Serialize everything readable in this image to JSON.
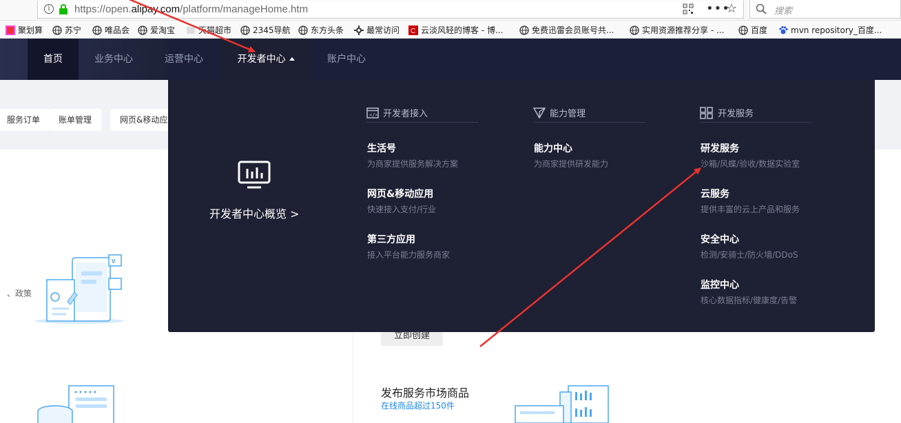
{
  "browser": {
    "url_prefix": "https://open.",
    "url_domain": "alipay.com",
    "url_path": "/platform/manageHome.htm",
    "search_placeholder": "搜索",
    "bookmarks": [
      "聚划算",
      "苏宁",
      "唯品会",
      "爱淘宝",
      "天猫超市",
      "2345导航",
      "东方头条",
      "最常访问",
      "云淡风轻的博客 - 博...",
      "免费迅雷会员账号共...",
      "实用资源推荐分享 - ...",
      "百度",
      "mvn repository_百度..."
    ]
  },
  "nav": {
    "items": [
      "首页",
      "业务中心",
      "运营中心",
      "开发者中心",
      "账户中心"
    ]
  },
  "page": {
    "pills": [
      "服务订单",
      "账单管理",
      "网页&移动应"
    ],
    "side_text": "、政策",
    "create_button": "立即创建",
    "publish_title": "发布服务市场商品",
    "publish_sub": "在线商品超过150件"
  },
  "dropdown": {
    "overview": "开发者中心概览 >",
    "columns": [
      {
        "heading": "开发者接入",
        "items": [
          {
            "title": "生活号",
            "desc": "为商家提供服务解决方案"
          },
          {
            "title": "网页&移动应用",
            "desc": "快速接入支付/行业"
          },
          {
            "title": "第三方应用",
            "desc": "接入平台能力服务商家"
          }
        ]
      },
      {
        "heading": "能力管理",
        "items": [
          {
            "title": "能力中心",
            "desc": "为商家提供研发能力"
          }
        ]
      },
      {
        "heading": "开发服务",
        "items": [
          {
            "title": "研发服务",
            "desc": "沙箱/风蝶/验收/数据实验室"
          },
          {
            "title": "云服务",
            "desc": "提供丰富的云上产品和服务"
          },
          {
            "title": "安全中心",
            "desc": "检测/安骑士/防火墙/DDoS"
          },
          {
            "title": "监控中心",
            "desc": "核心数据指标/健康度/告警"
          }
        ]
      }
    ]
  },
  "colors": {
    "nav_bg": "#1b1f3a",
    "dropdown_bg": "#1e2033",
    "annotation_arrow": "#e8322e"
  }
}
